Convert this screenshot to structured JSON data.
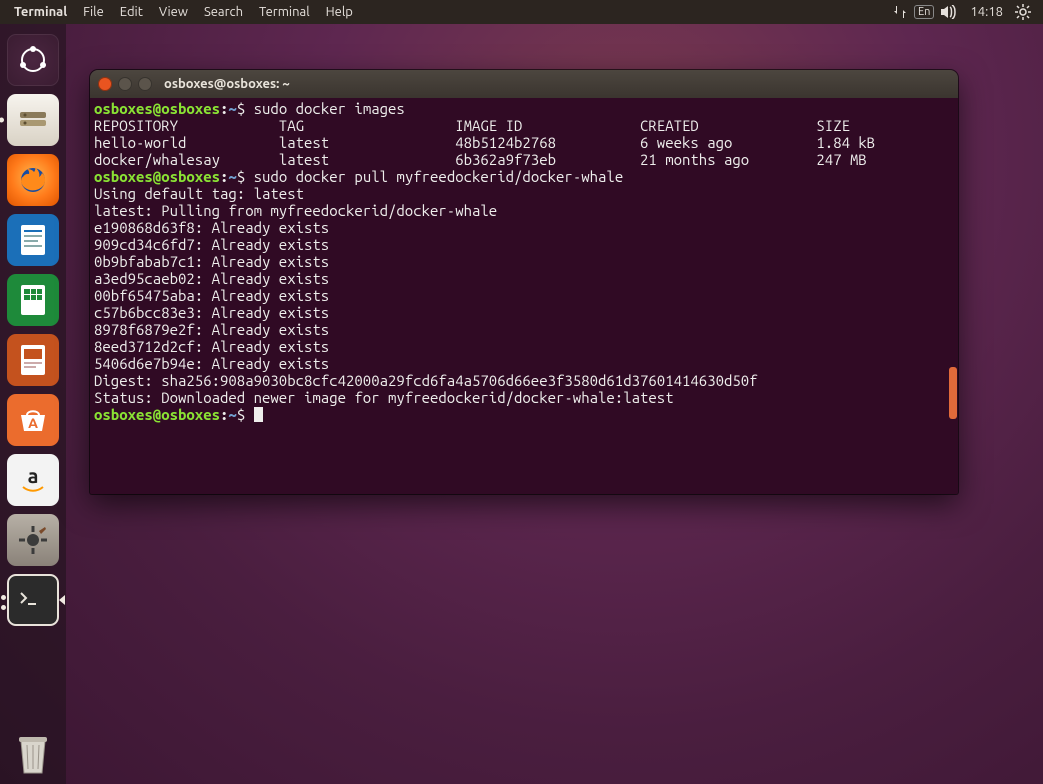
{
  "panel": {
    "app_name": "Terminal",
    "menus": [
      "Terminal",
      "File",
      "Edit",
      "View",
      "Search",
      "Terminal",
      "Help"
    ],
    "lang": "En",
    "time": "14:18"
  },
  "launcher": {
    "items": [
      {
        "name": "dash",
        "label": "Dash"
      },
      {
        "name": "files",
        "label": "Files"
      },
      {
        "name": "firefox",
        "label": "Firefox"
      },
      {
        "name": "writer",
        "label": "LibreOffice Writer"
      },
      {
        "name": "calc",
        "label": "LibreOffice Calc"
      },
      {
        "name": "impress",
        "label": "LibreOffice Impress"
      },
      {
        "name": "software",
        "label": "Ubuntu Software"
      },
      {
        "name": "amazon",
        "label": "Amazon"
      },
      {
        "name": "settings",
        "label": "System Settings"
      },
      {
        "name": "terminal",
        "label": "Terminal"
      }
    ],
    "trash": "Trash"
  },
  "window": {
    "title": "osboxes@osboxes: ~"
  },
  "prompt": {
    "user": "osboxes",
    "host": "osboxes",
    "path": "~",
    "sym": "$"
  },
  "cmd1": "sudo docker images",
  "table": {
    "headers": {
      "repo": "REPOSITORY",
      "tag": "TAG",
      "image_id": "IMAGE ID",
      "created": "CREATED",
      "size": "SIZE"
    },
    "rows": [
      {
        "repo": "hello-world",
        "tag": "latest",
        "image_id": "48b5124b2768",
        "created": "6 weeks ago",
        "size": "1.84 kB"
      },
      {
        "repo": "docker/whalesay",
        "tag": "latest",
        "image_id": "6b362a9f73eb",
        "created": "21 months ago",
        "size": "247 MB"
      }
    ]
  },
  "cmd2": "sudo docker pull myfreedockerid/docker-whale",
  "pull": {
    "default_tag": "Using default tag: latest",
    "pulling": "latest: Pulling from myfreedockerid/docker-whale",
    "layers": [
      "e190868d63f8: Already exists",
      "909cd34c6fd7: Already exists",
      "0b9bfabab7c1: Already exists",
      "a3ed95caeb02: Already exists",
      "00bf65475aba: Already exists",
      "c57b6bcc83e3: Already exists",
      "8978f6879e2f: Already exists",
      "8eed3712d2cf: Already exists",
      "5406d6e7b94e: Already exists"
    ],
    "digest": "Digest: sha256:908a9030bc8cfc42000a29fcd6fa4a5706d66ee3f3580d61d37601414630d50f",
    "status": "Status: Downloaded newer image for myfreedockerid/docker-whale:latest"
  }
}
